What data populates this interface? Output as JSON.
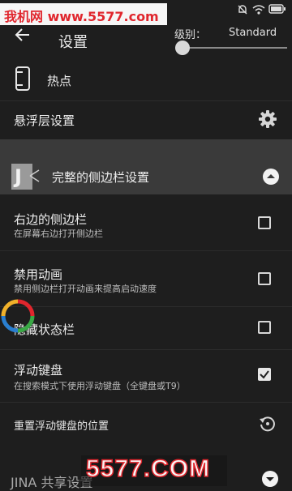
{
  "watermark_top": "我机网 www.5577.com",
  "status_bar": {
    "icons": [
      "mute-icon",
      "wifi-icon",
      "battery-icon"
    ]
  },
  "header": {
    "title": "设置",
    "level_label": "级别：",
    "level_value": "Standard",
    "level_fraction": 0.0
  },
  "hotspot_label": "热点",
  "floating_layer_label": "悬浮层设置",
  "section": {
    "title": "完整的侧边栏设置"
  },
  "settings": [
    {
      "title": "右边的侧边栏",
      "subtitle": "在屏幕右边打开侧边栏",
      "checked": false
    },
    {
      "title": "禁用动画",
      "subtitle": "禁用侧边栏打开动画来提高启动速度",
      "checked": false
    },
    {
      "title": "隐藏状态栏",
      "subtitle": "",
      "checked": false
    },
    {
      "title": "浮动键盘",
      "subtitle": "在搜索模式下使用浮动键盘（全键盘或T9）",
      "checked": true
    }
  ],
  "reset_label": "重置浮动键盘的位置",
  "share_label": "JINA 共享设置",
  "watermark_bottom": "5577.COM",
  "colors": {
    "background": "#1e1e1e",
    "section_bg": "#3a3a3a",
    "watermark_red": "#e0262d"
  }
}
